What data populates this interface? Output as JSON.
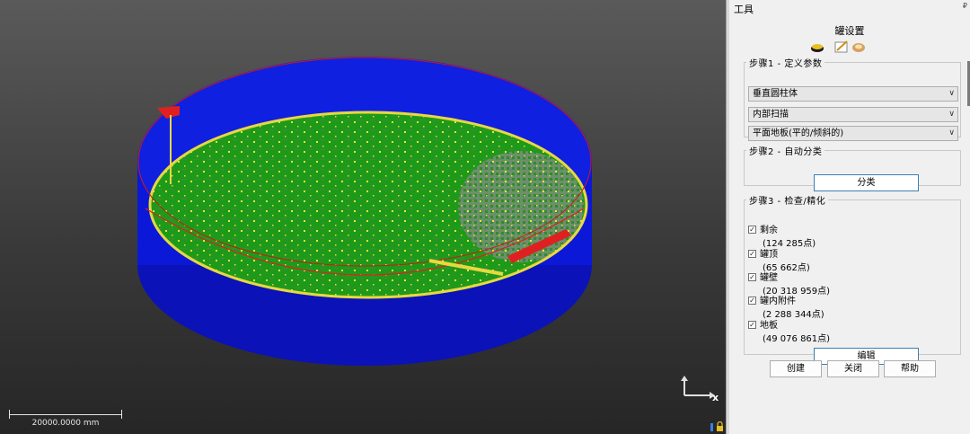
{
  "viewport": {
    "scale_label": "20000.0000 mm",
    "axis_label": "x",
    "colors": {
      "tank_wall": "#0b18d8",
      "floor": "#1e9a1a",
      "scan_points": "#f2e040",
      "tank_top": "#e02020"
    }
  },
  "panel": {
    "title": "工具",
    "pin": "₽",
    "dialog_title": "罐设置",
    "toolbar_icons": [
      "tank-icon",
      "edit-icon",
      "tank-settings-icon"
    ],
    "step1": {
      "legend": "步骤1 - 定义参数",
      "tank_type": "垂直圆柱体",
      "scan_type": "内部扫描",
      "floor_type": "平面地板(平的/倾斜的)"
    },
    "step2": {
      "legend": "步骤2 - 自动分类",
      "classify_label": "分类"
    },
    "step3": {
      "legend": "步骤3 - 检查/精化",
      "items": [
        {
          "label": "剩余",
          "count": "(124 285点)",
          "checked": true
        },
        {
          "label": "罐顶",
          "count": "(65 662点)",
          "checked": true
        },
        {
          "label": "罐壁",
          "count": "(20 318 959点)",
          "checked": true
        },
        {
          "label": "罐内附件",
          "count": "(2 288 344点)",
          "checked": true
        },
        {
          "label": "地板",
          "count": "(49 076 861点)",
          "checked": true
        }
      ],
      "edit_label": "编辑"
    },
    "footer": {
      "create_label": "创建",
      "close_label": "关闭",
      "help_label": "帮助"
    }
  }
}
